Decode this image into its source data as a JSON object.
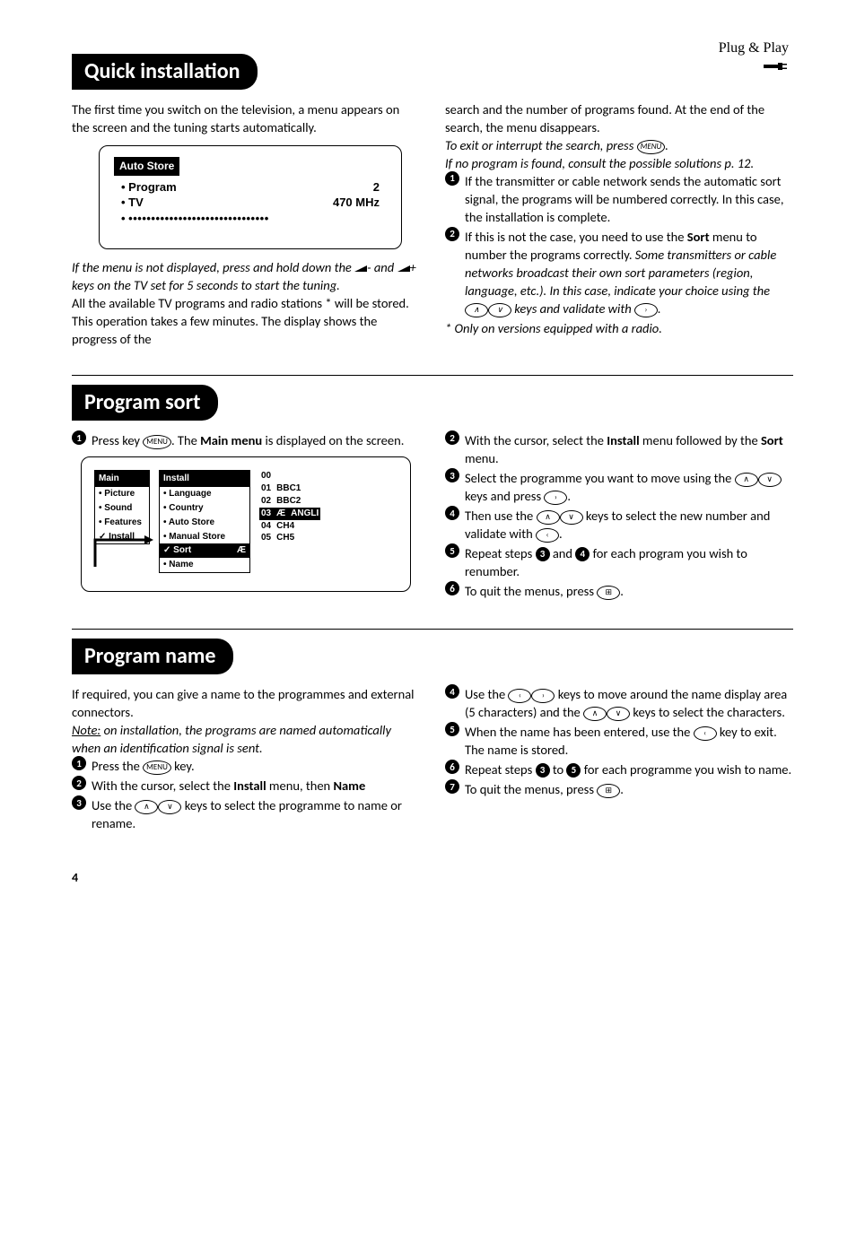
{
  "header": {
    "brand_text": "Plug & Play"
  },
  "quick_installation": {
    "title": "Quick installation",
    "left_intro": "The first time you switch on the television, a menu appears on the screen and the tuning starts automatically.",
    "auto_store": {
      "title": "Auto Store",
      "rows": [
        {
          "label": "Program",
          "value": "2"
        },
        {
          "label": "TV",
          "value": "470 MHz"
        }
      ],
      "dots": "•••••••••••••••••••••••••••••••"
    },
    "left_note_italic": "If the menu is not displayed, press and hold down the ",
    "left_note_italic_mid": "- and ",
    "left_note_italic_end": "+ keys on the TV set for 5 seconds to start the tuning.",
    "left_after": "All the available TV programs and radio stations * will be stored. This operation takes a few minutes. The display shows the progress of the",
    "right_intro": "search and the number of programs found. At the end of the search, the menu disappears.",
    "right_italic_1": "To exit or interrupt the search, press ",
    "right_italic_1_end": ".",
    "right_italic_2": "If no program is found, consult the possible solutions p. 12.",
    "bullet1": "If the transmitter or cable network sends the automatic sort signal, the programs will be numbered correctly. In this case, the installation is complete.",
    "bullet2_a": "If this is not the case, you need to use the ",
    "bullet2_sort": "Sort",
    "bullet2_b": " menu to number the programs correctly.",
    "bullet2_italic_a": "Some transmitters or cable networks broadcast their own sort parameters (region, language, etc.). In this case, indicate your choice using the ",
    "bullet2_italic_b": " keys and validate with ",
    "bullet2_italic_c": ".",
    "footnote": "*   Only on versions equipped with a radio."
  },
  "program_sort": {
    "title": "Program sort",
    "step1_a": "Press key ",
    "step1_b": ". The ",
    "step1_main": "Main menu",
    "step1_c": " is displayed on the screen.",
    "menu": {
      "main_header": "Main",
      "main_items": [
        "Picture",
        "Sound",
        "Features",
        "Install"
      ],
      "install_header": "Install",
      "install_items": [
        "Language",
        "Country",
        "Auto Store",
        "Manual Store",
        "Sort",
        "Name"
      ],
      "list_rows": [
        {
          "num": "00",
          "label": ""
        },
        {
          "num": "01",
          "label": "BBC1"
        },
        {
          "num": "02",
          "label": "BBC2"
        },
        {
          "num": "03",
          "label": "ANGLI",
          "sel": true,
          "marker": "Æ"
        },
        {
          "num": "04",
          "label": "CH4"
        },
        {
          "num": "05",
          "label": "CH5"
        }
      ]
    },
    "step2_a": "With the cursor, select the ",
    "step2_install": "Install",
    "step2_b": " menu followed by the ",
    "step2_sort": "Sort",
    "step2_c": " menu.",
    "step3_a": "Select the programme you want to move using the ",
    "step3_b": " keys and press ",
    "step3_c": ".",
    "step4_a": "Then use the ",
    "step4_b": " keys to select the new number and validate with ",
    "step4_c": ".",
    "step5_a": "Repeat steps ",
    "step5_b": " and ",
    "step5_c": " for each program you wish to renumber.",
    "step6_a": "To quit the menus, press ",
    "step6_b": "."
  },
  "program_name": {
    "title": "Program name",
    "intro": "If required, you can give a name to the programmes and external connectors.",
    "note_label": "Note:",
    "note_body": " on installation, the programs are named automatically when an identification signal is sent.",
    "step1_a": "Press the ",
    "step1_b": " key.",
    "step2_a": "With the cursor, select the ",
    "step2_install": "Install",
    "step2_b": " menu, then ",
    "step2_name": "Name",
    "step3_a": "Use the ",
    "step3_b": " keys to select the programme to name or rename.",
    "step4_a": "Use the ",
    "step4_b": " keys to move around the name display area (5 characters) and the ",
    "step4_c": " keys to select the characters.",
    "step5_a": "When the name has been entered, use the ",
    "step5_b": " key to exit. The name is stored.",
    "step6_a": "Repeat steps ",
    "step6_b": " to ",
    "step6_c": " for each programme you wish to name.",
    "step7_a": "To quit the menus, press ",
    "step7_b": "."
  },
  "icons": {
    "menu_key": "MENU",
    "up": "∧",
    "down": "∨",
    "left": "‹",
    "right": "›",
    "exit": "⊞"
  },
  "page_number": "4"
}
